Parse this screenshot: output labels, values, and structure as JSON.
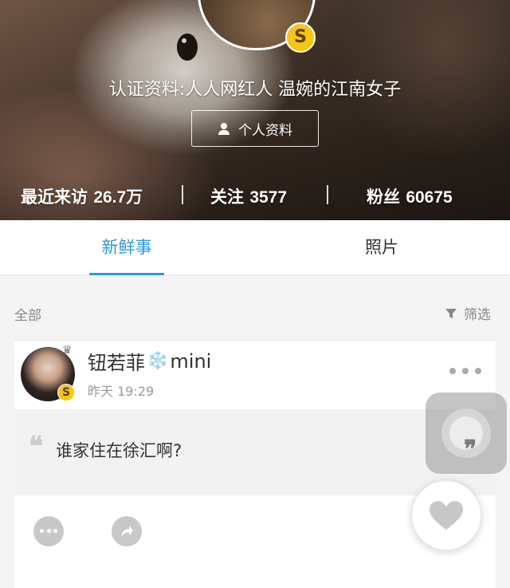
{
  "profile": {
    "certification": "认证资料:人人网红人 温婉的江南女子",
    "profile_button": "个人资料",
    "badge_letter": "S",
    "stats": {
      "recent_visits_label": "最近来访",
      "recent_visits_value": "26.7万",
      "following_label": "关注",
      "following_value": "3577",
      "fans_label": "粉丝",
      "fans_value": "60675"
    }
  },
  "tabs": [
    {
      "label": "新鲜事",
      "active": true
    },
    {
      "label": "照片",
      "active": false
    }
  ],
  "filter": {
    "all_label": "全部",
    "filter_label": "筛选"
  },
  "post": {
    "username": "钮若菲",
    "username_emoji": "❄️",
    "username_suffix": "mini",
    "badge_letter": "S",
    "time": "昨天 19:29",
    "content": "谁家住在徐汇啊?",
    "quote_mark": "❝"
  },
  "icons": {
    "profile_icon": "person-icon",
    "filter_icon": "funnel-icon",
    "comment_icon": "comment-icon",
    "share_icon": "share-icon",
    "like_icon": "heart-icon",
    "more_icon": "more-dots-icon"
  },
  "colors": {
    "accent": "#2c9ad9",
    "badge": "#f5c518"
  }
}
